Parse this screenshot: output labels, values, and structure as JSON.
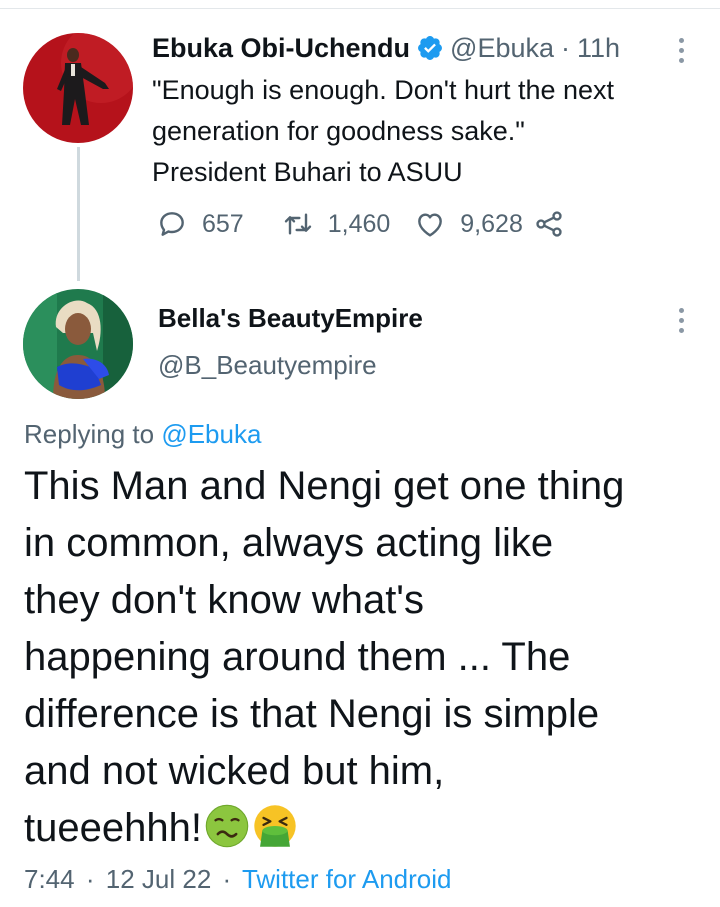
{
  "tweet": {
    "author_name": "Ebuka Obi-Uchendu",
    "author_handle": "@Ebuka",
    "separator": "·",
    "time_ago": "11h",
    "text_lines": [
      "\"Enough is enough. Don't hurt the next",
      "generation for goodness sake.\"",
      "President Buhari to ASUU"
    ],
    "replies": "657",
    "retweets": "1,460",
    "likes": "9,628",
    "icons": [
      "verified-badge-icon",
      "more-vertical-icon",
      "reply-icon",
      "retweet-icon",
      "like-icon",
      "share-icon"
    ]
  },
  "reply": {
    "author_name": "Bella's BeautyEmpire",
    "author_handle": "@B_Beautyempire",
    "replying_prefix": "Replying to",
    "replying_to": "@Ebuka",
    "text_lines": [
      "This Man and Nengi get one thing",
      "in common, always acting like",
      "they don't know what's",
      "happening around them ... The",
      "difference is that Nengi is simple",
      "and not wicked but him,",
      "tueeehhh!"
    ],
    "emojis": [
      "nauseated-face-emoji",
      "vomiting-face-emoji"
    ],
    "time": "7:44",
    "date": "12 Jul 22",
    "separator": "·",
    "source": "Twitter for Android"
  },
  "colors": {
    "link": "#1d9bf0",
    "muted": "#536471",
    "text": "#0f1419",
    "thread_line": "#cfd9de"
  }
}
